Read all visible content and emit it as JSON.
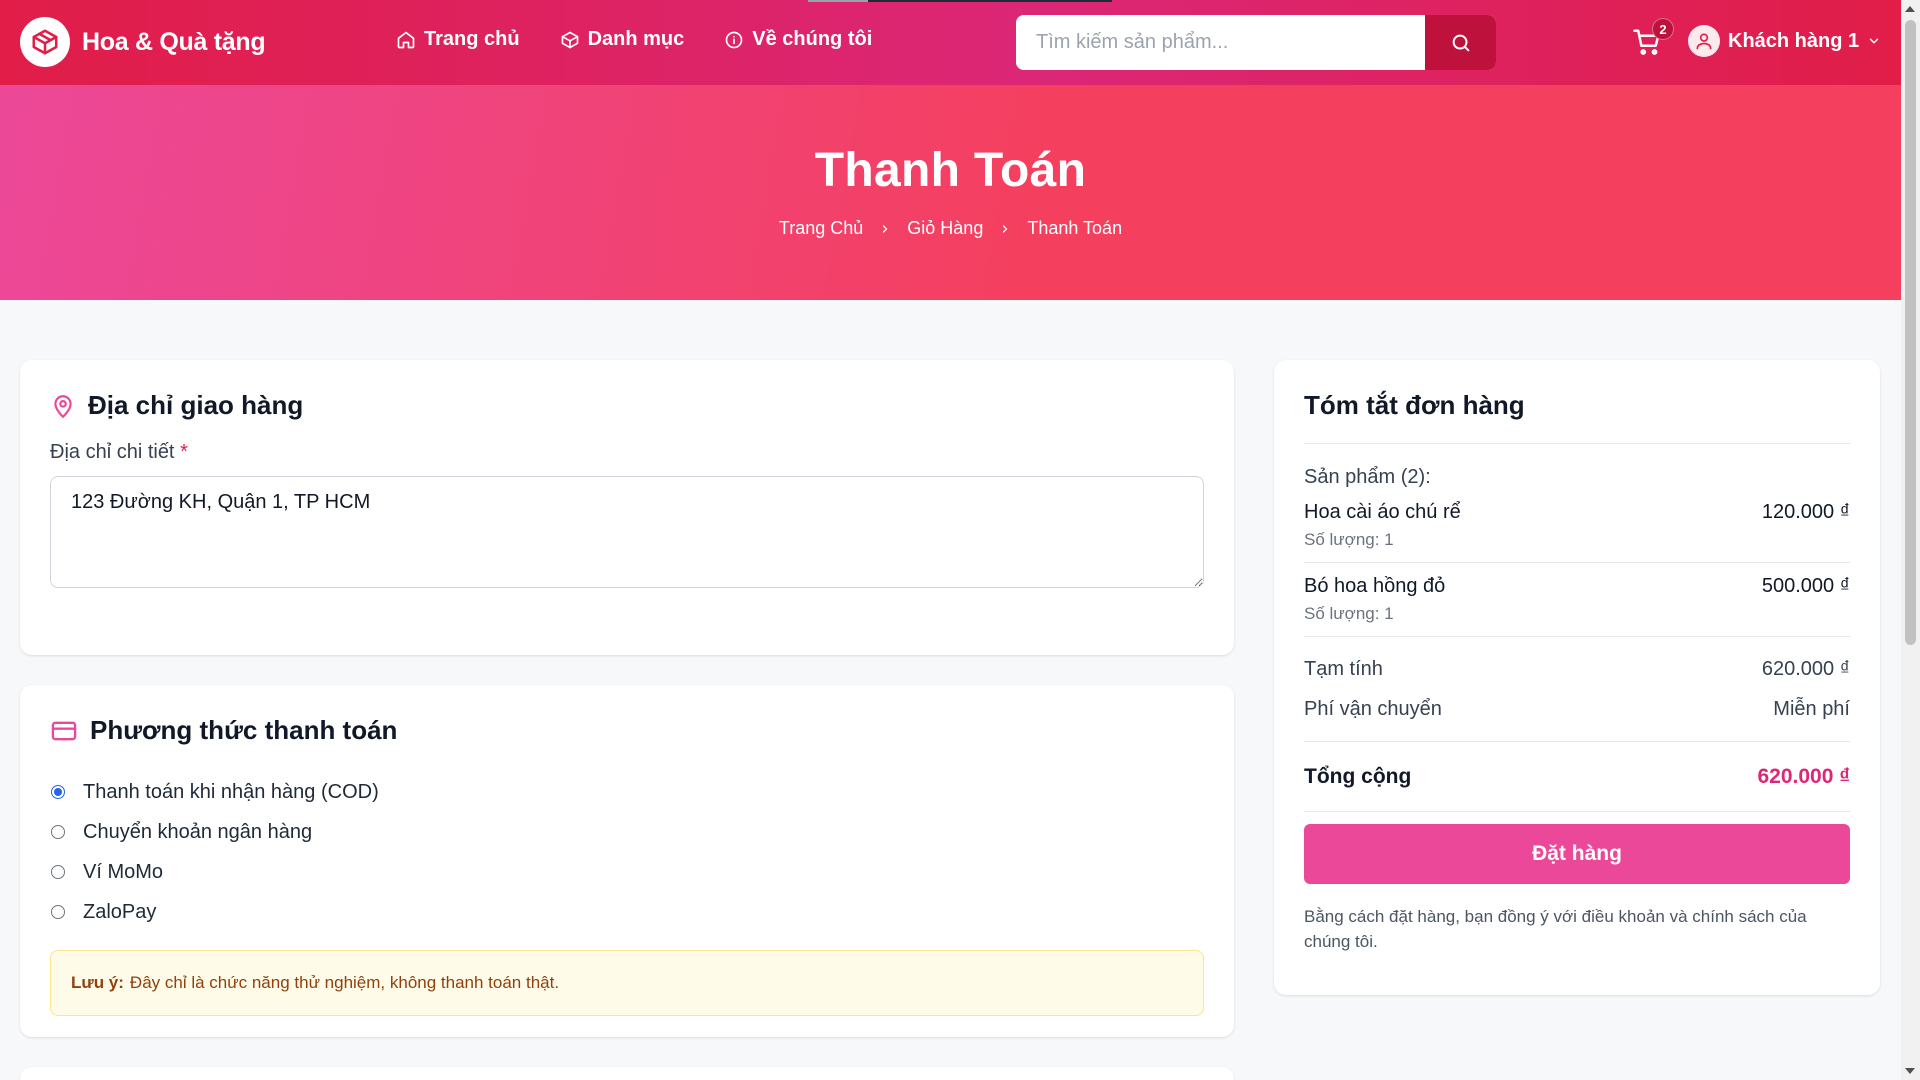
{
  "header": {
    "brand": "Hoa & Quà tặng",
    "nav": [
      {
        "label": "Trang chủ",
        "icon": "home-icon"
      },
      {
        "label": "Danh mục",
        "icon": "box-icon"
      },
      {
        "label": "Về chúng tôi",
        "icon": "info-icon"
      }
    ],
    "search_placeholder": "Tìm kiếm sản phẩm...",
    "cart_count": "2",
    "user_name": "Khách hàng 1"
  },
  "hero": {
    "title": "Thanh Toán",
    "breadcrumbs": [
      "Trang Chủ",
      "Giỏ Hàng",
      "Thanh Toán"
    ]
  },
  "address": {
    "title": "Địa chỉ giao hàng",
    "label": "Địa chỉ chi tiết",
    "required_mark": "*",
    "value": "123 Đường KH, Quận 1, TP HCM"
  },
  "payment": {
    "title": "Phương thức thanh toán",
    "options": [
      {
        "label": "Thanh toán khi nhận hàng (COD)",
        "selected": true
      },
      {
        "label": "Chuyển khoản ngân hàng",
        "selected": false
      },
      {
        "label": "Ví MoMo",
        "selected": false
      },
      {
        "label": "ZaloPay",
        "selected": false
      }
    ],
    "note_label": "Lưu ý:",
    "note_text": "Đây chỉ là chức năng thử nghiệm, không thanh toán thật."
  },
  "summary": {
    "title": "Tóm tắt đơn hàng",
    "count_label": "Sản phẩm (2):",
    "items": [
      {
        "name": "Hoa cài áo chú rể",
        "qty": "Số lượng: 1",
        "price": "120.000 ₫"
      },
      {
        "name": "Bó hoa hồng đỏ",
        "qty": "Số lượng: 1",
        "price": "500.000 ₫"
      }
    ],
    "subtotal_label": "Tạm tính",
    "subtotal": "620.000 ₫",
    "shipping_label": "Phí vận chuyển",
    "shipping": "Miễn phí",
    "total_label": "Tổng cộng",
    "total": "620.000 ₫",
    "order_button": "Đặt hàng",
    "terms": "Bằng cách đặt hàng, bạn đồng ý với điều khoản và chính sách của chúng tôi."
  },
  "colors": {
    "header": "#e11d48",
    "accent": "#ec4899",
    "total": "#db2777"
  }
}
